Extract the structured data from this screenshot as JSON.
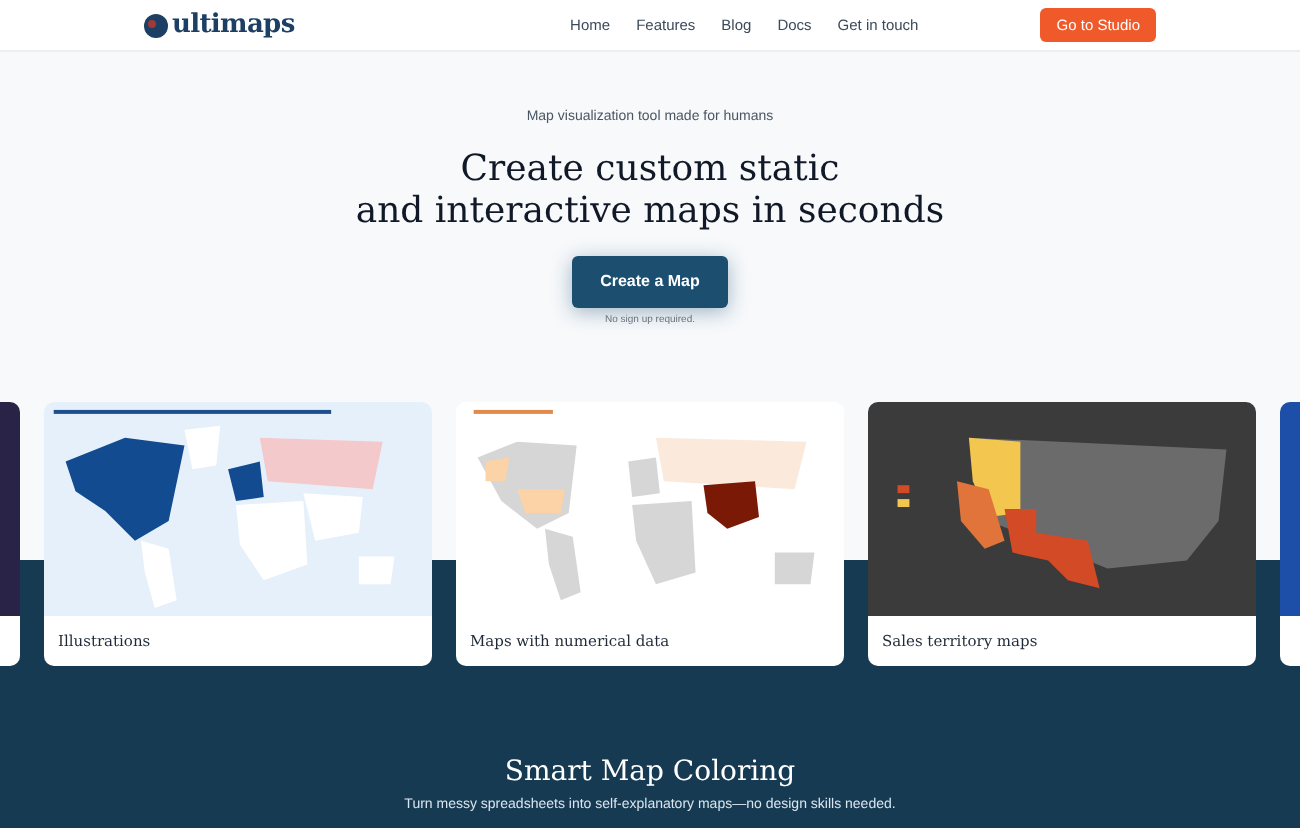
{
  "nav": {
    "logo": "ultimaps",
    "links": [
      "Home",
      "Features",
      "Blog",
      "Docs",
      "Get in touch"
    ],
    "cta": "Go to Studio"
  },
  "hero": {
    "eyebrow": "Map visualization tool made for humans",
    "title_lines": [
      "Create custom static",
      "and interactive maps in seconds"
    ],
    "button": "Create a Map",
    "note": "No sign up required."
  },
  "cards": [
    {
      "kind": "illustration",
      "caption": "Illustrations"
    },
    {
      "kind": "numerical",
      "caption": "Maps with numerical data"
    },
    {
      "kind": "sales",
      "caption": "Sales territory maps"
    }
  ],
  "section": {
    "title": "Smart Map Coloring",
    "subtitle": "Turn messy spreadsheets into self-explanatory maps—no design skills needed."
  }
}
